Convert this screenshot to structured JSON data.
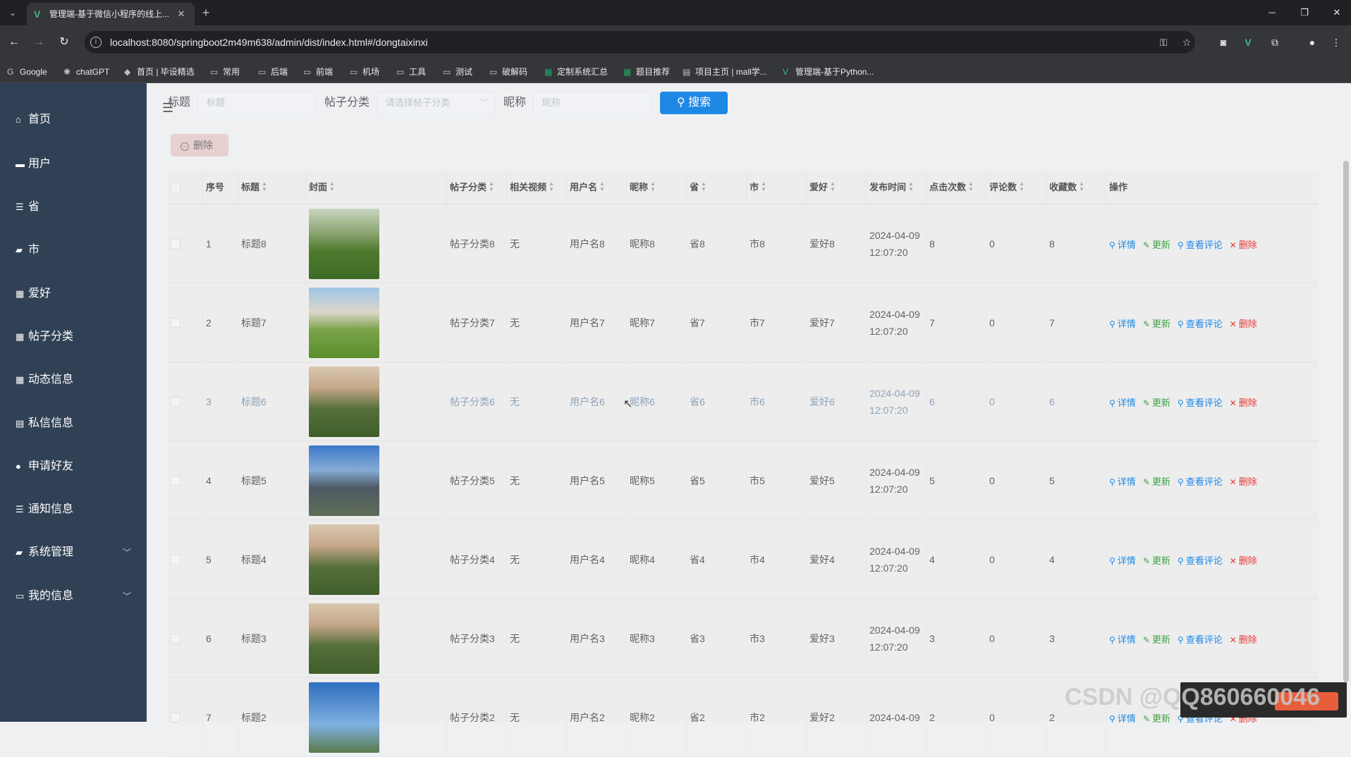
{
  "browser": {
    "tab_title": "管理端-基于微信小程序的线上...",
    "url": "localhost:8080/springboot2m49m638/admin/dist/index.html#/dongtaixinxi",
    "bookmarks": [
      "Google",
      "chatGPT",
      "首页 | 毕设精选",
      "常用",
      "后端",
      "前端",
      "机场",
      "工具",
      "测试",
      "破解码",
      "定制系统汇总",
      "题目推荐",
      "项目主页 | mall学...",
      "管理端-基于Python..."
    ]
  },
  "sidebar": {
    "items": [
      {
        "label": "首页",
        "icon": "home-icon"
      },
      {
        "label": "用户",
        "icon": "user-card-icon"
      },
      {
        "label": "省",
        "icon": "sliders-icon"
      },
      {
        "label": "市",
        "icon": "chat-icon"
      },
      {
        "label": "爱好",
        "icon": "grid-icon"
      },
      {
        "label": "帖子分类",
        "icon": "grid-icon"
      },
      {
        "label": "动态信息",
        "icon": "grid-icon"
      },
      {
        "label": "私信信息",
        "icon": "clipboard-icon"
      },
      {
        "label": "申请好友",
        "icon": "person-icon"
      },
      {
        "label": "通知信息",
        "icon": "list-icon"
      },
      {
        "label": "系统管理",
        "icon": "chat-icon"
      },
      {
        "label": "我的信息",
        "icon": "card-icon"
      }
    ]
  },
  "search": {
    "title_label": "标题",
    "title_placeholder": "标题",
    "category_label": "帖子分类",
    "category_placeholder": "请选择帖子分类",
    "nickname_label": "昵称",
    "nickname_placeholder": "昵称",
    "search_button": "搜索",
    "delete_button": "删除"
  },
  "table": {
    "headers": [
      "序号",
      "标题",
      "封面",
      "帖子分类",
      "相关视频",
      "用户名",
      "昵称",
      "省",
      "市",
      "爱好",
      "发布时间",
      "点击次数",
      "评论数",
      "收藏数",
      "操作"
    ],
    "actions": {
      "detail": "详情",
      "update": "更新",
      "comments": "查看评论",
      "delete": "删除"
    },
    "rows": [
      {
        "no": "1",
        "title": "标题8",
        "category": "帖子分类8",
        "video": "无",
        "username": "用户名8",
        "nickname": "昵称8",
        "province": "省8",
        "city": "市8",
        "hobby": "爱好8",
        "date": "2024-04-09",
        "time": "12:07:20",
        "clicks": "8",
        "comments": "0",
        "favs": "8"
      },
      {
        "no": "2",
        "title": "标题7",
        "category": "帖子分类7",
        "video": "无",
        "username": "用户名7",
        "nickname": "昵称7",
        "province": "省7",
        "city": "市7",
        "hobby": "爱好7",
        "date": "2024-04-09",
        "time": "12:07:20",
        "clicks": "7",
        "comments": "0",
        "favs": "7"
      },
      {
        "no": "3",
        "title": "标题6",
        "category": "帖子分类6",
        "video": "无",
        "username": "用户名6",
        "nickname": "昵称6",
        "province": "省6",
        "city": "市6",
        "hobby": "爱好6",
        "date": "2024-04-09",
        "time": "12:07:20",
        "clicks": "6",
        "comments": "0",
        "favs": "6"
      },
      {
        "no": "4",
        "title": "标题5",
        "category": "帖子分类5",
        "video": "无",
        "username": "用户名5",
        "nickname": "昵称5",
        "province": "省5",
        "city": "市5",
        "hobby": "爱好5",
        "date": "2024-04-09",
        "time": "12:07:20",
        "clicks": "5",
        "comments": "0",
        "favs": "5"
      },
      {
        "no": "5",
        "title": "标题4",
        "category": "帖子分类4",
        "video": "无",
        "username": "用户名4",
        "nickname": "昵称4",
        "province": "省4",
        "city": "市4",
        "hobby": "爱好4",
        "date": "2024-04-09",
        "time": "12:07:20",
        "clicks": "4",
        "comments": "0",
        "favs": "4"
      },
      {
        "no": "6",
        "title": "标题3",
        "category": "帖子分类3",
        "video": "无",
        "username": "用户名3",
        "nickname": "昵称3",
        "province": "省3",
        "city": "市3",
        "hobby": "爱好3",
        "date": "2024-04-09",
        "time": "12:07:20",
        "clicks": "3",
        "comments": "0",
        "favs": "3"
      },
      {
        "no": "7",
        "title": "标题2",
        "category": "帖子分类2",
        "video": "无",
        "username": "用户名2",
        "nickname": "昵称2",
        "province": "省2",
        "city": "市2",
        "hobby": "爱好2",
        "date": "2024-04-09",
        "time": "",
        "clicks": "2",
        "comments": "0",
        "favs": "2"
      }
    ]
  },
  "overlay": {
    "watermark": "CSDN @QQ860660046"
  }
}
